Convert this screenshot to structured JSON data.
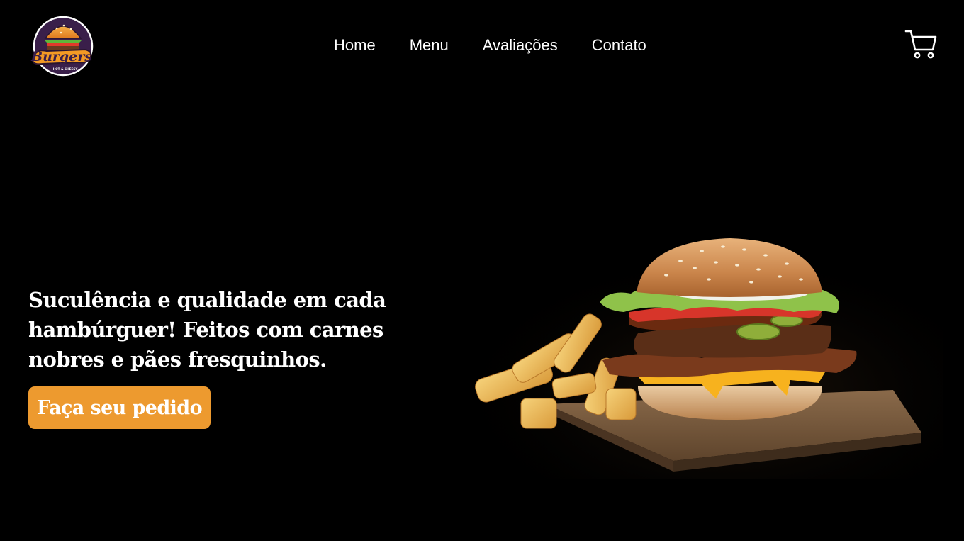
{
  "brand": {
    "logo_text": "Burgers",
    "logo_tagline": "HOT & CHEESY",
    "logo_icon": "burger-logo-icon"
  },
  "nav": {
    "items": [
      {
        "label": "Home"
      },
      {
        "label": "Menu"
      },
      {
        "label": "Avaliações"
      },
      {
        "label": "Contato"
      }
    ]
  },
  "header": {
    "cart_icon": "cart-icon"
  },
  "hero": {
    "headline": "Suculência e qualidade em cada hambúrguer! Feitos com carnes nobres e pães fresquinhos.",
    "cta_label": "Faça seu pedido",
    "image_icon": "burger-and-fries-image"
  },
  "colors": {
    "background": "#000000",
    "text": "#ffffff",
    "accent": "#ed9a2f"
  }
}
